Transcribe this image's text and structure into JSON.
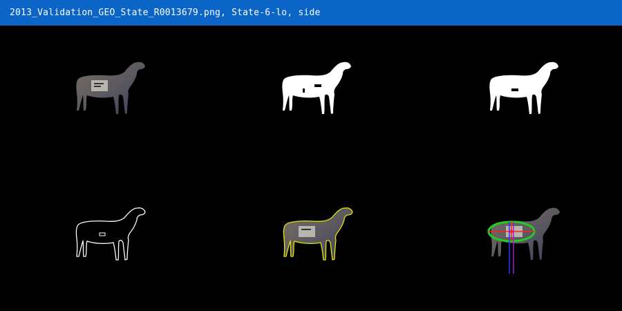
{
  "window": {
    "title": "2013_Validation_GEO_State_R0013679.png, State-6-lo, side"
  },
  "panels": [
    {
      "name": "original-photo",
      "kind": "photo"
    },
    {
      "name": "binary-mask",
      "kind": "mask"
    },
    {
      "name": "refined-mask",
      "kind": "mask"
    },
    {
      "name": "contour-outline",
      "kind": "outline"
    },
    {
      "name": "contour-overlay",
      "kind": "overlay"
    },
    {
      "name": "measurement-overlay",
      "kind": "measurement"
    }
  ],
  "colors": {
    "titlebar": "#0a65c6",
    "background": "#000000",
    "mask": "#ffffff",
    "contour_overlay": "#e6e600",
    "ellipse": "#22cc22",
    "axis_major": "#ff2020",
    "axis_minor": "#3030ff",
    "axis_vertical": "#a020c0"
  }
}
